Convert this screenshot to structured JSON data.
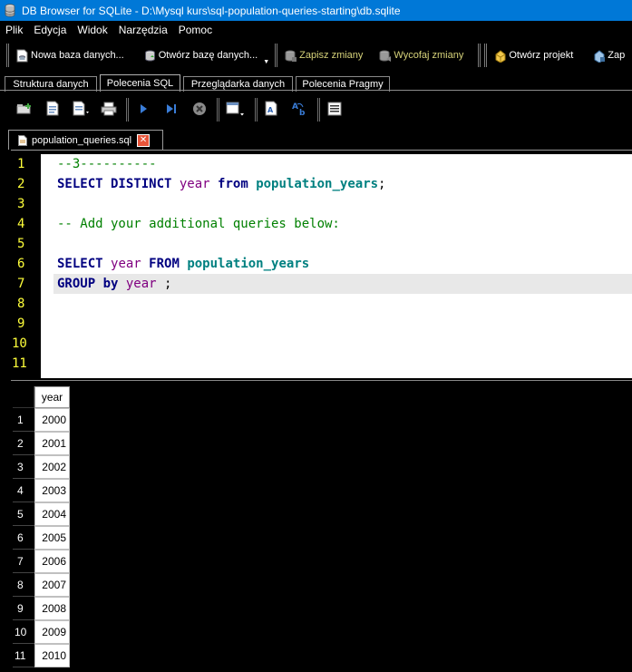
{
  "window": {
    "title": "DB Browser for SQLite - D:\\Mysql kurs\\sql-population-queries-starting\\db.sqlite"
  },
  "menu": [
    {
      "label": "Plik"
    },
    {
      "label": "Edycja"
    },
    {
      "label": "Widok"
    },
    {
      "label": "Narzędzia"
    },
    {
      "label": "Pomoc"
    }
  ],
  "toolbar": {
    "new_db": "Nowa baza danych...",
    "open_db": "Otwórz bazę danych...",
    "write_changes": "Zapisz zmiany",
    "revert_changes": "Wycofaj zmiany",
    "open_project": "Otwórz projekt",
    "save_project": "Zap"
  },
  "tabs": [
    {
      "label": "Struktura danych",
      "active": false
    },
    {
      "label": "Polecenia SQL",
      "active": true
    },
    {
      "label": "Przeglądarka danych",
      "active": false
    },
    {
      "label": "Polecenia Pragmy",
      "active": false
    }
  ],
  "editor": {
    "file_tab": "population_queries.sql",
    "line_numbers": [
      "1",
      "2",
      "3",
      "4",
      "5",
      "6",
      "7",
      "8",
      "9",
      "10",
      "11"
    ],
    "lines": {
      "l1": "--3----------",
      "l2_kw": "SELECT DISTINCT",
      "l2_col": "year",
      "l2_from": "from",
      "l2_tbl": "population_years",
      "l2_end": ";",
      "l4": "-- Add your additional queries below:",
      "l6_kw": "SELECT",
      "l6_col": "year",
      "l6_from": "FROM",
      "l6_tbl": "population_years",
      "l7_kw": "GROUP by",
      "l7_col": "year",
      "l7_end": ";"
    }
  },
  "results": {
    "column": "year",
    "rows": [
      {
        "n": "1",
        "year": "2000"
      },
      {
        "n": "2",
        "year": "2001"
      },
      {
        "n": "3",
        "year": "2002"
      },
      {
        "n": "4",
        "year": "2003"
      },
      {
        "n": "5",
        "year": "2004"
      },
      {
        "n": "6",
        "year": "2005"
      },
      {
        "n": "7",
        "year": "2006"
      },
      {
        "n": "8",
        "year": "2007"
      },
      {
        "n": "9",
        "year": "2008"
      },
      {
        "n": "10",
        "year": "2009"
      },
      {
        "n": "11",
        "year": "2010"
      }
    ]
  },
  "colors": {
    "titlebar": "#0078d7",
    "line_numbers": "#ffff3a",
    "keyword": "#000080",
    "identifier": "#800080",
    "table": "#008080",
    "comment": "#008000"
  }
}
